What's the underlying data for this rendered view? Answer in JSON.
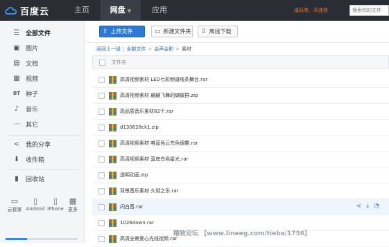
{
  "topbar": {
    "logo_text": "百度云",
    "nav": {
      "home": "主页",
      "disk": "网盘",
      "app": "应用"
    },
    "user_links": "填码卷、高速费",
    "search_placeholder": "搜索你的文件"
  },
  "sidebar": {
    "items": [
      {
        "label": "全部文件",
        "icon": "all-files-icon"
      },
      {
        "label": "图片",
        "icon": "image-icon"
      },
      {
        "label": "文档",
        "icon": "document-icon"
      },
      {
        "label": "视频",
        "icon": "video-icon"
      },
      {
        "label": "种子",
        "icon": "torrent-icon"
      },
      {
        "label": "音乐",
        "icon": "music-icon"
      },
      {
        "label": "其它",
        "icon": "other-icon"
      },
      {
        "label": "我的分享",
        "icon": "share-icon"
      },
      {
        "label": "收件箱",
        "icon": "inbox-icon"
      },
      {
        "label": "回收站",
        "icon": "trash-icon"
      }
    ],
    "devices": [
      "云管家",
      "Android",
      "iPhone",
      "更多"
    ]
  },
  "toolbar": {
    "upload": "上传文件",
    "new_folder": "新建文件夹",
    "offline_download": "离线下载"
  },
  "breadcrumb": {
    "back": "返回上一级",
    "all_files": "全部文件",
    "parent": "会声会影",
    "current": "素材"
  },
  "table": {
    "header_name": "文件名",
    "rows": [
      "高清视频素材 LED七彩频谱线条舞台.rar",
      "高清视频素材 翩翩飞舞的蝴蝶群.zip",
      "高品质音乐素材82个.rar",
      "d130628ck1.zip",
      "高清视频素材 唯蓝色云东色烟雾.rar",
      "高清视频素材 蓝底白色星光.rar",
      "透明动画.zip",
      "背景音乐素材 久彻之乐.rar",
      "闪白音.rar",
      "1026down.rar",
      "高清全景爱心光线视频.rar"
    ]
  },
  "watermark": "精致论坛  【www.lineeg.com/tieba/1756】",
  "colors": {
    "topbar": "#2a2d33",
    "accent": "#2d7ad6",
    "link": "#2d6bbf",
    "user_links": "#e46d2a"
  }
}
